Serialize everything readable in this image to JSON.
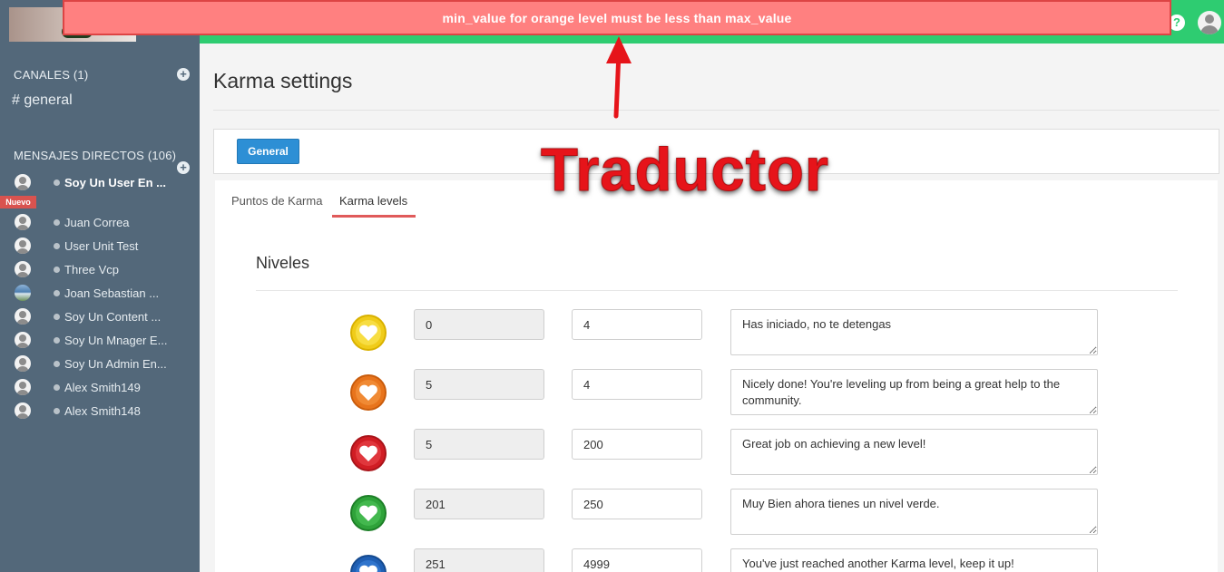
{
  "alert": {
    "message": "min_value for orange level must be less than max_value"
  },
  "sidebar": {
    "channels_header": "CANALES (1)",
    "channels": [
      {
        "label": "# general"
      }
    ],
    "dm_header": "MENSAJES DIRECTOS (106)",
    "new_badge": "Nuevo",
    "direct_messages": [
      {
        "name": "Soy Un User En ..."
      },
      {
        "name": "Juan Correa"
      },
      {
        "name": "User Unit Test"
      },
      {
        "name": "Three Vcp"
      },
      {
        "name": "Joan Sebastian ..."
      },
      {
        "name": "Soy Un Content ..."
      },
      {
        "name": "Soy Un Mnager E..."
      },
      {
        "name": "Soy Un Admin En..."
      },
      {
        "name": "Alex Smith149"
      },
      {
        "name": "Alex Smith148"
      }
    ]
  },
  "header": {
    "help_icon": "?"
  },
  "main": {
    "title": "Karma settings",
    "general_button": "General",
    "tabs": [
      {
        "label": "Puntos de Karma"
      },
      {
        "label": "Karma levels"
      }
    ],
    "section_title": "Niveles",
    "levels": [
      {
        "color": "#f0cc1a",
        "icon": "yellow-heart",
        "min": "0",
        "max": "4",
        "description": "Has iniciado, no te detengas"
      },
      {
        "color": "#e8741c",
        "icon": "orange-heart",
        "min": "5",
        "max": "4",
        "description": "Nicely done! You're leveling up from being a great help to the community."
      },
      {
        "color": "#d11d24",
        "icon": "red-heart",
        "min": "5",
        "max": "200",
        "description": "Great job on achieving a new level!"
      },
      {
        "color": "#2fa33a",
        "icon": "green-heart",
        "min": "201",
        "max": "250",
        "description": "Muy Bien ahora tienes un nivel verde."
      },
      {
        "color": "#1f5fb4",
        "icon": "blue-heart",
        "min": "251",
        "max": "4999",
        "description": "You've just reached another Karma level, keep it up!"
      }
    ]
  },
  "annotation": {
    "label": "Traductor",
    "color": "#e6141a"
  }
}
